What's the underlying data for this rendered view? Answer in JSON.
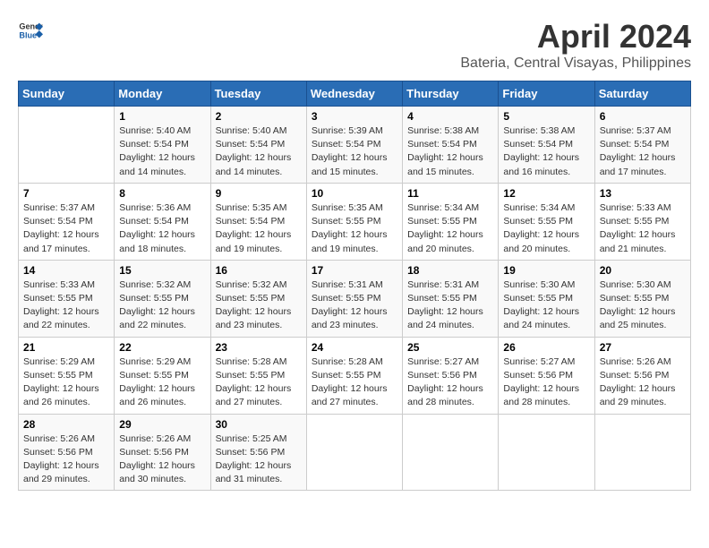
{
  "header": {
    "logo_general": "General",
    "logo_blue": "Blue",
    "title": "April 2024",
    "subtitle": "Bateria, Central Visayas, Philippines"
  },
  "days_of_week": [
    "Sunday",
    "Monday",
    "Tuesday",
    "Wednesday",
    "Thursday",
    "Friday",
    "Saturday"
  ],
  "weeks": [
    [
      {
        "day": "",
        "info": ""
      },
      {
        "day": "1",
        "info": "Sunrise: 5:40 AM\nSunset: 5:54 PM\nDaylight: 12 hours\nand 14 minutes."
      },
      {
        "day": "2",
        "info": "Sunrise: 5:40 AM\nSunset: 5:54 PM\nDaylight: 12 hours\nand 14 minutes."
      },
      {
        "day": "3",
        "info": "Sunrise: 5:39 AM\nSunset: 5:54 PM\nDaylight: 12 hours\nand 15 minutes."
      },
      {
        "day": "4",
        "info": "Sunrise: 5:38 AM\nSunset: 5:54 PM\nDaylight: 12 hours\nand 15 minutes."
      },
      {
        "day": "5",
        "info": "Sunrise: 5:38 AM\nSunset: 5:54 PM\nDaylight: 12 hours\nand 16 minutes."
      },
      {
        "day": "6",
        "info": "Sunrise: 5:37 AM\nSunset: 5:54 PM\nDaylight: 12 hours\nand 17 minutes."
      }
    ],
    [
      {
        "day": "7",
        "info": "Sunrise: 5:37 AM\nSunset: 5:54 PM\nDaylight: 12 hours\nand 17 minutes."
      },
      {
        "day": "8",
        "info": "Sunrise: 5:36 AM\nSunset: 5:54 PM\nDaylight: 12 hours\nand 18 minutes."
      },
      {
        "day": "9",
        "info": "Sunrise: 5:35 AM\nSunset: 5:54 PM\nDaylight: 12 hours\nand 19 minutes."
      },
      {
        "day": "10",
        "info": "Sunrise: 5:35 AM\nSunset: 5:55 PM\nDaylight: 12 hours\nand 19 minutes."
      },
      {
        "day": "11",
        "info": "Sunrise: 5:34 AM\nSunset: 5:55 PM\nDaylight: 12 hours\nand 20 minutes."
      },
      {
        "day": "12",
        "info": "Sunrise: 5:34 AM\nSunset: 5:55 PM\nDaylight: 12 hours\nand 20 minutes."
      },
      {
        "day": "13",
        "info": "Sunrise: 5:33 AM\nSunset: 5:55 PM\nDaylight: 12 hours\nand 21 minutes."
      }
    ],
    [
      {
        "day": "14",
        "info": "Sunrise: 5:33 AM\nSunset: 5:55 PM\nDaylight: 12 hours\nand 22 minutes."
      },
      {
        "day": "15",
        "info": "Sunrise: 5:32 AM\nSunset: 5:55 PM\nDaylight: 12 hours\nand 22 minutes."
      },
      {
        "day": "16",
        "info": "Sunrise: 5:32 AM\nSunset: 5:55 PM\nDaylight: 12 hours\nand 23 minutes."
      },
      {
        "day": "17",
        "info": "Sunrise: 5:31 AM\nSunset: 5:55 PM\nDaylight: 12 hours\nand 23 minutes."
      },
      {
        "day": "18",
        "info": "Sunrise: 5:31 AM\nSunset: 5:55 PM\nDaylight: 12 hours\nand 24 minutes."
      },
      {
        "day": "19",
        "info": "Sunrise: 5:30 AM\nSunset: 5:55 PM\nDaylight: 12 hours\nand 24 minutes."
      },
      {
        "day": "20",
        "info": "Sunrise: 5:30 AM\nSunset: 5:55 PM\nDaylight: 12 hours\nand 25 minutes."
      }
    ],
    [
      {
        "day": "21",
        "info": "Sunrise: 5:29 AM\nSunset: 5:55 PM\nDaylight: 12 hours\nand 26 minutes."
      },
      {
        "day": "22",
        "info": "Sunrise: 5:29 AM\nSunset: 5:55 PM\nDaylight: 12 hours\nand 26 minutes."
      },
      {
        "day": "23",
        "info": "Sunrise: 5:28 AM\nSunset: 5:55 PM\nDaylight: 12 hours\nand 27 minutes."
      },
      {
        "day": "24",
        "info": "Sunrise: 5:28 AM\nSunset: 5:55 PM\nDaylight: 12 hours\nand 27 minutes."
      },
      {
        "day": "25",
        "info": "Sunrise: 5:27 AM\nSunset: 5:56 PM\nDaylight: 12 hours\nand 28 minutes."
      },
      {
        "day": "26",
        "info": "Sunrise: 5:27 AM\nSunset: 5:56 PM\nDaylight: 12 hours\nand 28 minutes."
      },
      {
        "day": "27",
        "info": "Sunrise: 5:26 AM\nSunset: 5:56 PM\nDaylight: 12 hours\nand 29 minutes."
      }
    ],
    [
      {
        "day": "28",
        "info": "Sunrise: 5:26 AM\nSunset: 5:56 PM\nDaylight: 12 hours\nand 29 minutes."
      },
      {
        "day": "29",
        "info": "Sunrise: 5:26 AM\nSunset: 5:56 PM\nDaylight: 12 hours\nand 30 minutes."
      },
      {
        "day": "30",
        "info": "Sunrise: 5:25 AM\nSunset: 5:56 PM\nDaylight: 12 hours\nand 31 minutes."
      },
      {
        "day": "",
        "info": ""
      },
      {
        "day": "",
        "info": ""
      },
      {
        "day": "",
        "info": ""
      },
      {
        "day": "",
        "info": ""
      }
    ]
  ]
}
